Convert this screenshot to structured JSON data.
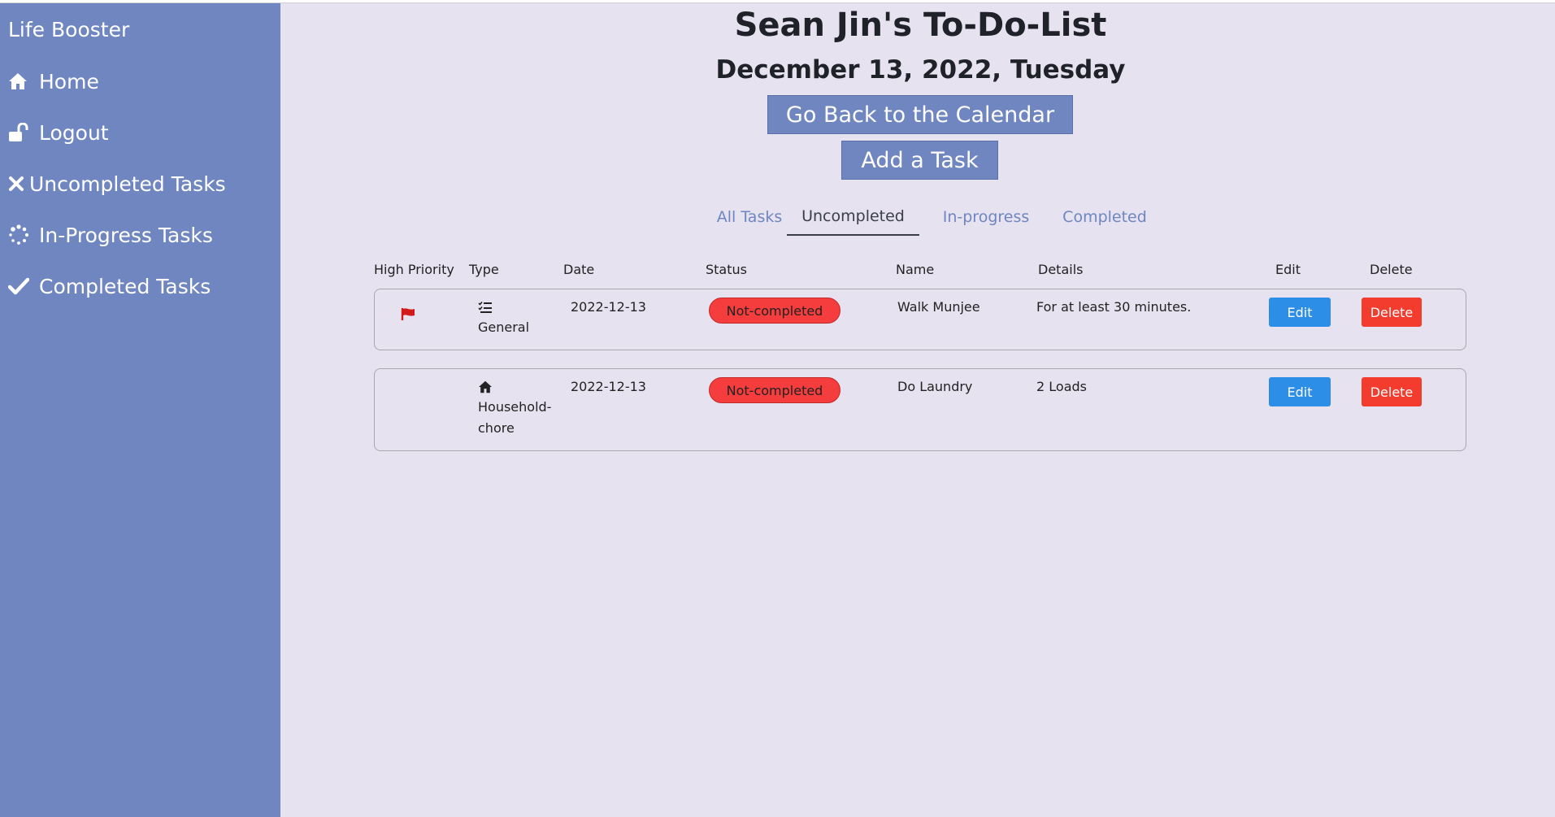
{
  "app": {
    "brand": "Life Booster"
  },
  "sidebar": {
    "items": [
      {
        "label": "Home",
        "icon": "home-icon"
      },
      {
        "label": "Logout",
        "icon": "unlock-icon"
      },
      {
        "label": "Uncompleted Tasks",
        "icon": "x-icon"
      },
      {
        "label": "In-Progress Tasks",
        "icon": "spinner-icon"
      },
      {
        "label": "Completed Tasks",
        "icon": "check-icon"
      }
    ]
  },
  "header": {
    "title": "Sean Jin's To-Do-List",
    "date": "December 13, 2022, Tuesday",
    "calendar_button": "Go Back to the Calendar",
    "add_button": "Add a Task"
  },
  "tabs": [
    {
      "label": "All Tasks",
      "active": false
    },
    {
      "label": "Uncompleted",
      "active": true
    },
    {
      "label": "In-progress",
      "active": false
    },
    {
      "label": "Completed",
      "active": false
    }
  ],
  "table": {
    "headers": [
      "High Priority",
      "Type",
      "Date",
      "Status",
      "Name",
      "Details",
      "Edit",
      "Delete"
    ],
    "rows": [
      {
        "high_priority": true,
        "type_icon": "checklist-icon",
        "type": "General",
        "date": "2022-12-13",
        "status": "Not-completed",
        "name": "Walk Munjee",
        "details": "For at least 30 minutes.",
        "edit_label": "Edit",
        "delete_label": "Delete"
      },
      {
        "high_priority": false,
        "type_icon": "home-icon",
        "type": "Household-chore",
        "type_line1": "Household-",
        "type_line2": "chore",
        "date": "2022-12-13",
        "status": "Not-completed",
        "name": "Do Laundry",
        "details": "2 Loads",
        "edit_label": "Edit",
        "delete_label": "Delete"
      }
    ]
  },
  "colors": {
    "sidebar": "#6f86c0",
    "background": "#e6e2ef",
    "status_badge": "#f53d3d",
    "edit_button": "#2d8ee8",
    "delete_button": "#f33b2e",
    "priority_flag": "#d11a1a"
  }
}
